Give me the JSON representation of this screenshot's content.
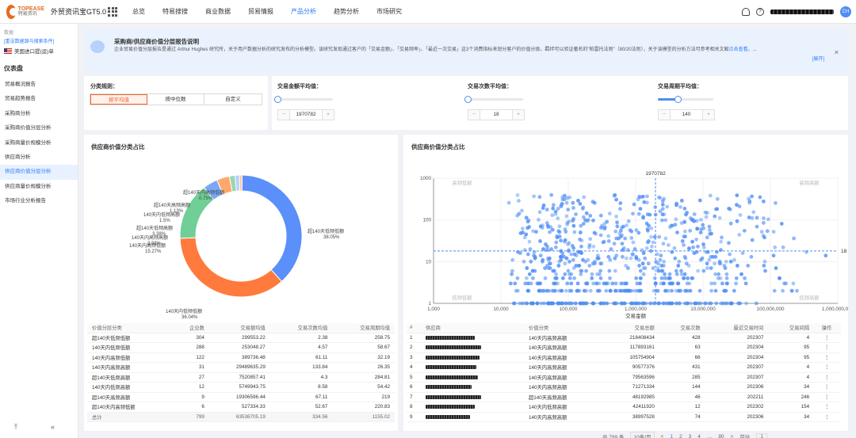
{
  "header": {
    "logo_brand": "TOPEASE",
    "logo_sub": "特易资讯",
    "app_title": "外贸资讯宝GT5.0",
    "nav": [
      {
        "label": "总览",
        "active": false
      },
      {
        "label": "特易搜搜",
        "active": false
      },
      {
        "label": "商业数据",
        "active": false
      },
      {
        "label": "贸易情报",
        "active": false
      },
      {
        "label": "产品分析",
        "active": true
      },
      {
        "label": "趋势分析",
        "active": false
      },
      {
        "label": "市场研究",
        "active": false
      }
    ],
    "help_icon": "?",
    "avatar": "CH"
  },
  "sidebar": {
    "data_label": "数据",
    "reset_link": "[重设数据源与搜索条件]",
    "country": "美国进口提(运)单",
    "heading": "仪表盘",
    "items": [
      {
        "label": "贸易概况报告",
        "active": false
      },
      {
        "label": "贸易趋势报告",
        "active": false
      },
      {
        "label": "采购商分析",
        "active": false
      },
      {
        "label": "采购商价值分层分析",
        "active": false
      },
      {
        "label": "采购商量价规模分析",
        "active": false
      },
      {
        "label": "供应商分析",
        "active": false
      },
      {
        "label": "供应商价值分层分析",
        "active": true
      },
      {
        "label": "供应商量价规模分析",
        "active": false
      },
      {
        "label": "市场行业分析报告",
        "active": false
      }
    ],
    "bottom_left": "⤒",
    "bottom_right": "«"
  },
  "notice": {
    "title": "采购商/供应商价值分层报告说明",
    "body": "企业贸易价值分层报告是通过 Arthur Hughes 研究所，关于用户数据分析的研究发布的分析模型。该研究发现通过客户的「交易金额」、「交易频率」、「最近一次交易」这3个消费指标来划分客户的价值分级，羁绊可以验证著名的\"帕雷托法则\"（80/20法则），关于该模型的分析方法可参考相关文献",
    "link_text": "点击查看。",
    "ellipsis": "...",
    "expand": "[展开]",
    "close": "×"
  },
  "filters": {
    "rule_label": "分类规则：",
    "rule_options": [
      {
        "label": "按平均值",
        "active": true
      },
      {
        "label": "按中位数",
        "active": false
      },
      {
        "label": "自定义",
        "active": false
      }
    ],
    "amount_label": "交易金额平均值：",
    "amount_value": "1970782",
    "amount_slider": 0.0,
    "count_label": "交易次数平均值：",
    "count_value": "18",
    "count_slider": 0.0,
    "cycle_label": "交易周期平均值：",
    "cycle_value": "140",
    "cycle_slider": 0.35,
    "minus": "−",
    "plus": "+"
  },
  "left_panel": {
    "title": "供应商价值分类占比",
    "donut": [
      {
        "label": "超140天低频低额",
        "pct": "38.05%",
        "value": 38.05,
        "color": "#5b8ff9"
      },
      {
        "label": "140天内低频低额",
        "pct": "36.04%",
        "value": 36.04,
        "color": "#ff7a3d"
      },
      {
        "label": "140天内高频低额",
        "pct": "15.27%",
        "value": 15.27,
        "color": "#6fcf97"
      },
      {
        "label": "140天内高频高额",
        "pct": "3.88%",
        "value": 3.88,
        "color": "#7aa7f7"
      },
      {
        "label": "超140天低频高额",
        "pct": "3.38%",
        "value": 3.38,
        "color": "#ffa86b"
      },
      {
        "label": "140天内低频高额",
        "pct": "1.5%",
        "value": 1.5,
        "color": "#9ad6b1"
      },
      {
        "label": "超140天高频高额",
        "pct": "1.13%",
        "value": 1.13,
        "color": "#b7cff9"
      },
      {
        "label": "超140天内高频低额",
        "pct": "0.75%",
        "value": 0.75,
        "color": "#ffc6a3"
      }
    ],
    "table_headers": [
      "价值分层分类",
      "企业数",
      "交易额均值",
      "交易次数均值",
      "交易周期均值"
    ],
    "rows": [
      [
        "超140天低频低额",
        "304",
        "299553.22",
        "2.38",
        "258.75"
      ],
      [
        "140天内低频低额",
        "288",
        "253048.27",
        "4.57",
        "58.67"
      ],
      [
        "140天内高频低额",
        "122",
        "389736.48",
        "61.11",
        "32.19"
      ],
      [
        "140天内高频高额",
        "31",
        "29489635.29",
        "133.84",
        "26.35"
      ],
      [
        "超140天低频高额",
        "27",
        "7520857.41",
        "4.3",
        "284.81"
      ],
      [
        "140天内低频高额",
        "12",
        "5749943.75",
        "8.58",
        "54.42"
      ],
      [
        "超140天高频高额",
        "9",
        "19306596.44",
        "67.11",
        "219"
      ],
      [
        "超140天内高频低额",
        "6",
        "527334.33",
        "52.67",
        "220.83"
      ]
    ],
    "total": [
      "总计",
      "799",
      "63536705.19",
      "334.56",
      "1155.02"
    ]
  },
  "right_panel": {
    "title": "供应商价值分类占比",
    "chart_data": {
      "type": "scatter",
      "xlabel": "交易金额",
      "ylabel": "",
      "xscale": "log",
      "yscale": "log",
      "xlim": [
        1000,
        1000000000
      ],
      "ylim": [
        1,
        1000
      ],
      "x_ticks": [
        "1,000",
        "10,000",
        "100,000",
        "1,000,000",
        "10,000,000",
        "100,000,000",
        "1,000,000,000"
      ],
      "y_ticks": [
        "1000",
        "100",
        "10",
        "1"
      ],
      "ref_x": 1970782,
      "ref_x_label": "1970782",
      "ref_y": 18,
      "ref_y_label": "18",
      "quadrants": [
        "高频低额",
        "高频高额",
        "低频低额",
        "低频高额"
      ],
      "point_count": 799
    },
    "table_headers": [
      "#",
      "供应商",
      "价值分类",
      "交易总额",
      "交易次数",
      "最近交易时间",
      "交易间隔",
      "操作"
    ],
    "rows": [
      [
        "1",
        "140天内高频高额",
        "218408434",
        "428",
        "202307",
        "4"
      ],
      [
        "2",
        "140天内高频高额",
        "117893161",
        "63",
        "202304",
        "95"
      ],
      [
        "3",
        "140天内高频高额",
        "105754904",
        "66",
        "202304",
        "95"
      ],
      [
        "4",
        "140天内高频高额",
        "90577376",
        "431",
        "202307",
        "4"
      ],
      [
        "5",
        "140天内高频高额",
        "79563596",
        "285",
        "202307",
        "4"
      ],
      [
        "6",
        "140天内高频高额",
        "71271334",
        "144",
        "202306",
        "34"
      ],
      [
        "7",
        "超140天高频高额",
        "48192985",
        "46",
        "202211",
        "246"
      ],
      [
        "8",
        "140天内低频高额",
        "42411920",
        "12",
        "202302",
        "154"
      ],
      [
        "9",
        "140天内高频高额",
        "38997528",
        "74",
        "202306",
        "34"
      ]
    ],
    "op_icon": "⋮",
    "pager": {
      "total": "共 799 条",
      "size": "10条/页",
      "pages": [
        "1",
        "2",
        "3",
        "4",
        "…",
        "80"
      ],
      "prev": "<",
      "next": ">",
      "goto": "前往",
      "goto_value": "1"
    }
  }
}
